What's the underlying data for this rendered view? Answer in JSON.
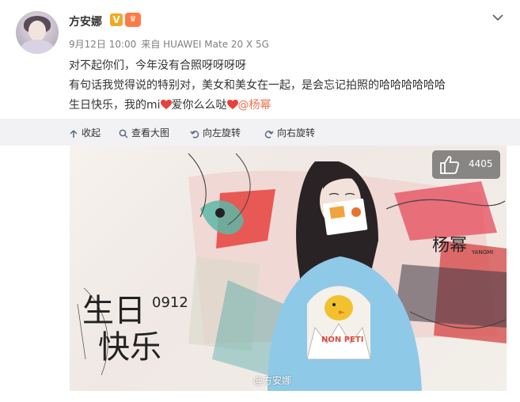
{
  "post": {
    "username": "方安娜",
    "v_badge": "V",
    "crown_badge": "♛",
    "date": "9月12日 10:00",
    "source": "来自 HUAWEI Mate 20 X 5G",
    "lines": {
      "line1": "对不起你们，今年没有合照呀呀呀呀",
      "line2": "有句话我觉得说的特别对，美女和美女在一起，是会忘记拍照的哈哈哈哈哈哈",
      "line3_a": "生日快乐，我的mi",
      "line3_b": "爱你么么哒",
      "mention": "@杨幂"
    }
  },
  "toolbar": {
    "collapse": "收起",
    "view_large": "查看大图",
    "rotate_left": "向左旋转",
    "rotate_right": "向右旋转"
  },
  "photo": {
    "like_count": "4405",
    "watermark": "@方安娜",
    "art_name": "杨幂",
    "art_name_en": "YANGMI",
    "birthday_text_1": "生日",
    "birthday_text_2": "快乐",
    "birthday_date": "0912"
  },
  "colors": {
    "mention": "#eb7350",
    "heart": "#e8413c",
    "sweater": "#8fc9e8",
    "toolbar_bg": "#f2f2f5"
  }
}
